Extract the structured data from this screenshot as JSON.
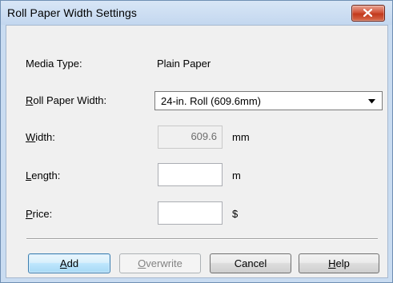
{
  "window": {
    "title": "Roll Paper Width Settings"
  },
  "form": {
    "media_type_label": "Media Type:",
    "media_type_value": "Plain Paper",
    "roll_width_label_mnemonic": "R",
    "roll_width_label_rest": "oll Paper Width:",
    "roll_width_selected": "24-in. Roll (609.6mm)",
    "width_label_mnemonic": "W",
    "width_label_rest": "idth:",
    "width_value": "609.6",
    "width_unit": "mm",
    "length_label_mnemonic": "L",
    "length_label_rest": "ength:",
    "length_value": "",
    "length_unit": "m",
    "price_label_mnemonic": "P",
    "price_label_rest": "rice:",
    "price_value": "",
    "price_unit": "$"
  },
  "buttons": {
    "add_mnemonic": "A",
    "add_rest": "dd",
    "overwrite_mnemonic": "O",
    "overwrite_rest": "verwrite",
    "cancel": "Cancel",
    "help_mnemonic": "H",
    "help_rest": "elp"
  },
  "icons": {
    "close": "close-icon",
    "dropdown": "chevron-down-icon"
  },
  "colors": {
    "close_button": "#c2391c",
    "primary_button_border": "#3c7fb1",
    "dialog_background": "#f0f0f0"
  }
}
